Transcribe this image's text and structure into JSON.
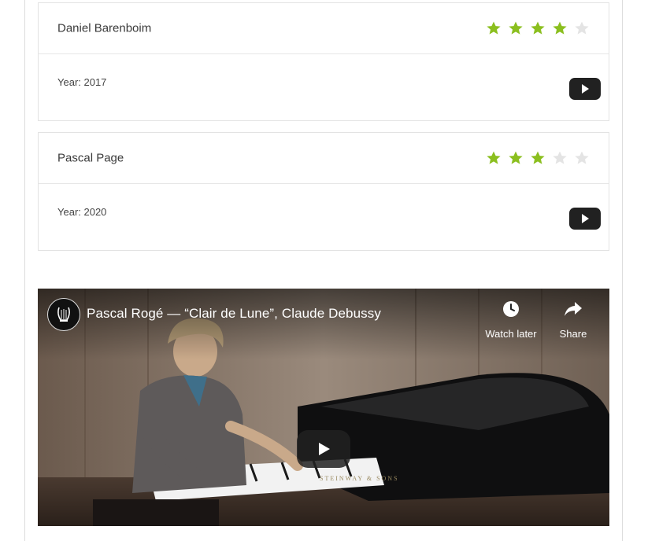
{
  "cards": [
    {
      "name": "Daniel Barenboim",
      "year_text": "Year: 2017",
      "rating": 4,
      "max_rating": 5
    },
    {
      "name": "Pascal Page",
      "year_text": "Year: 2020",
      "rating": 3,
      "max_rating": 5
    }
  ],
  "video": {
    "title": "Pascal Rogé — “Clair de Lune”, Claude Debussy",
    "watch_later": "Watch later",
    "share": "Share",
    "piano_brand": "STEINWAY & SONS"
  },
  "colors": {
    "star_filled": "#8bbf1f",
    "star_empty": "#e4e4e4",
    "play_button": "#212121"
  }
}
